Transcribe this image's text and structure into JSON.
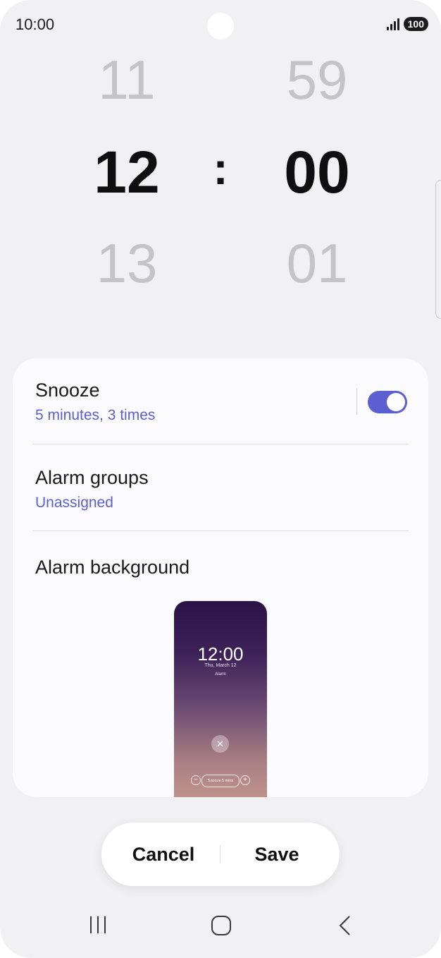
{
  "status_bar": {
    "time": "10:00",
    "battery": "100"
  },
  "time_picker": {
    "hours": {
      "prev": "11",
      "current": "12",
      "next": "13"
    },
    "separator": ":",
    "minutes": {
      "prev": "59",
      "current": "00",
      "next": "01"
    }
  },
  "settings": {
    "snooze": {
      "title": "Snooze",
      "subtitle": "5 minutes, 3 times",
      "enabled": true
    },
    "alarm_groups": {
      "title": "Alarm groups",
      "subtitle": "Unassigned"
    },
    "alarm_background": {
      "title": "Alarm background",
      "preview": {
        "time": "12:00",
        "date": "Thu, March 12",
        "label": "Alarm",
        "snooze_label": "Snooze 5 mins"
      }
    }
  },
  "actions": {
    "cancel": "Cancel",
    "save": "Save"
  },
  "nav_bar": {
    "icons": [
      "recents-icon",
      "home-icon",
      "back-icon"
    ]
  },
  "colors": {
    "accent": "#5b5fcf",
    "background": "#f1f1f4",
    "card": "#fbfbfd"
  }
}
